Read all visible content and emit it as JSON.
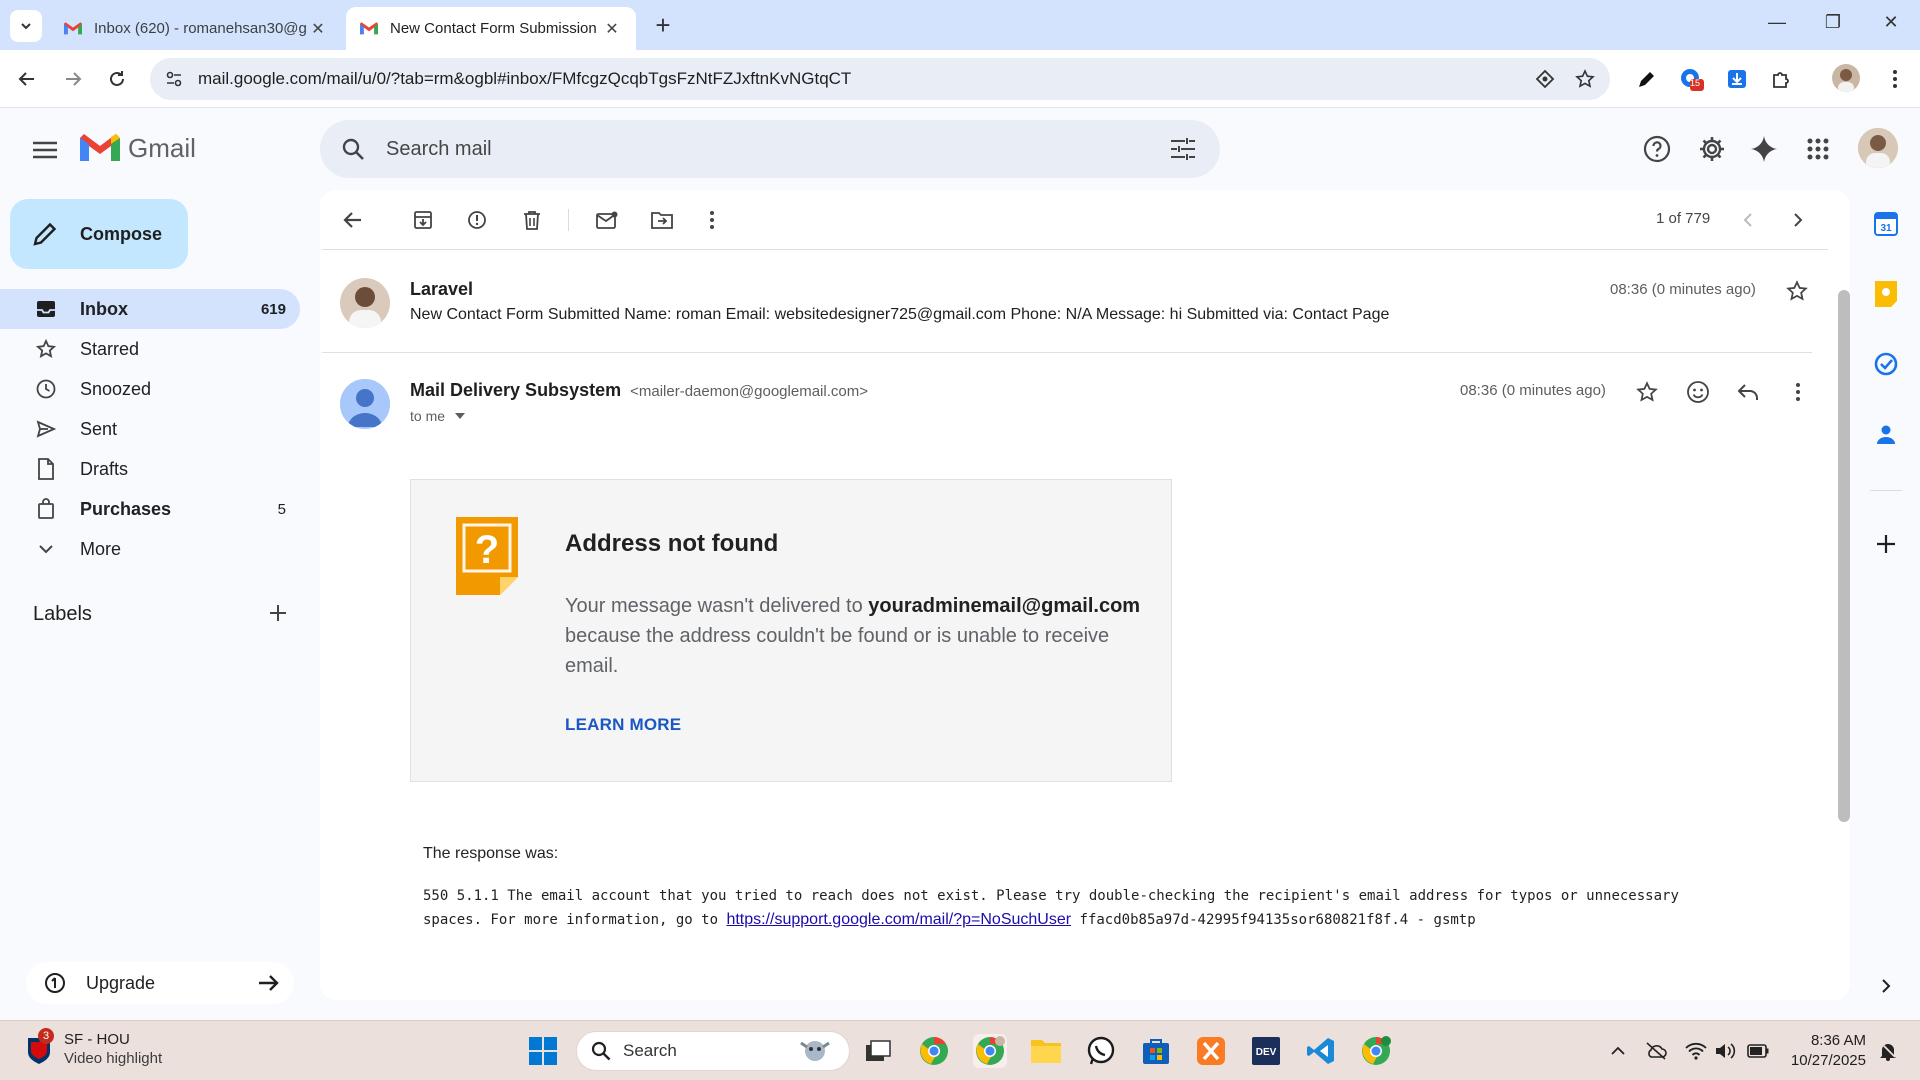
{
  "browser": {
    "tabs": [
      {
        "title": "Inbox (620) - romanehsan30@g",
        "active": false
      },
      {
        "title": "New Contact Form Submission",
        "active": true
      }
    ],
    "url": "mail.google.com/mail/u/0/?tab=rm&ogbl#inbox/FMfcgzQcqbTgsFzNtFZJxftnKvNGtqCT",
    "extension_badge": "15"
  },
  "gmail": {
    "logo_text": "Gmail",
    "search_placeholder": "Search mail",
    "compose_label": "Compose",
    "nav": [
      {
        "label": "Inbox",
        "count": "619",
        "icon": "inbox-icon"
      },
      {
        "label": "Starred",
        "count": "",
        "icon": "star-icon"
      },
      {
        "label": "Snoozed",
        "count": "",
        "icon": "clock-icon"
      },
      {
        "label": "Sent",
        "count": "",
        "icon": "send-icon"
      },
      {
        "label": "Drafts",
        "count": "",
        "icon": "draft-icon"
      },
      {
        "label": "Purchases",
        "count": "5",
        "icon": "bag-icon"
      },
      {
        "label": "More",
        "count": "",
        "icon": "chevron-down-icon"
      }
    ],
    "labels_title": "Labels",
    "upgrade_label": "Upgrade"
  },
  "thread": {
    "pager": "1 of 779",
    "collapsed_message": {
      "sender": "Laravel",
      "time": "08:36 (0 minutes ago)",
      "snippet": "New Contact Form Submitted Name: roman Email: websitedesigner725@gmail.com Phone: N/A Message: hi Submitted via: Contact Page"
    },
    "open_message": {
      "sender": "Mail Delivery Subsystem",
      "sender_email": "<mailer-daemon@googlemail.com>",
      "recipient": "to me",
      "time": "08:36 (0 minutes ago)",
      "bounce_title": "Address not found",
      "bounce_body_prefix": "Your message wasn't delivered to",
      "bounce_address": "youradminemail@gmail.com",
      "bounce_body_suffix": "because the address couldn't be found or is unable to receive email.",
      "learn_more": "LEARN MORE",
      "response_label": "The response was:",
      "response_text_1": "550 5.1.1 The email account that you tried to reach does not exist. Please try double-checking the recipient's email address for typos or unnecessary spaces. For more information, go to",
      "response_link": "https://support.google.com/mail/?p=NoSuchUser",
      "response_text_2": "ffacd0b85a97d-42995f94135sor680821f8f.4 - gsmtp"
    }
  },
  "taskbar": {
    "news_badge": "3",
    "news_title": "SF - HOU",
    "news_sub": "Video highlight",
    "search_label": "Search",
    "time": "8:36 AM",
    "date": "10/27/2025"
  },
  "colors": {
    "accent_blue": "#0b57d0",
    "compose_bg": "#c2e7ff",
    "active_nav_bg": "#d3e3fd",
    "bounce_icon": "#f29900"
  }
}
